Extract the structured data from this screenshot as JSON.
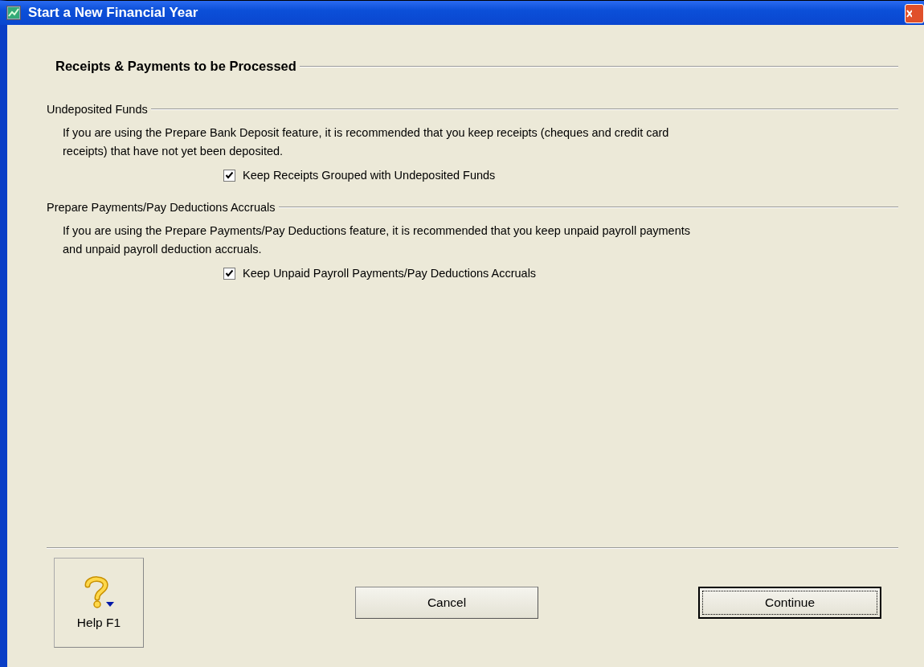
{
  "window": {
    "title": "Start a New Financial Year"
  },
  "heading": "Receipts & Payments to be Processed",
  "sections": [
    {
      "title": "Undeposited Funds",
      "description": "If you are using the Prepare Bank Deposit feature, it is recommended that you keep receipts (cheques and credit card receipts) that have not yet been deposited.",
      "option": {
        "label": "Keep Receipts Grouped with Undeposited Funds",
        "checked": true
      }
    },
    {
      "title": "Prepare Payments/Pay Deductions Accruals",
      "description": "If you are using the Prepare Payments/Pay Deductions feature, it is recommended that you keep unpaid payroll payments and unpaid payroll deduction accruals.",
      "option": {
        "label": "Keep Unpaid Payroll Payments/Pay Deductions Accruals",
        "checked": true
      }
    }
  ],
  "help_button": {
    "label": "Help F1"
  },
  "buttons": [
    {
      "label": "Cancel",
      "default": false
    },
    {
      "label": "Continue",
      "default": true
    }
  ]
}
